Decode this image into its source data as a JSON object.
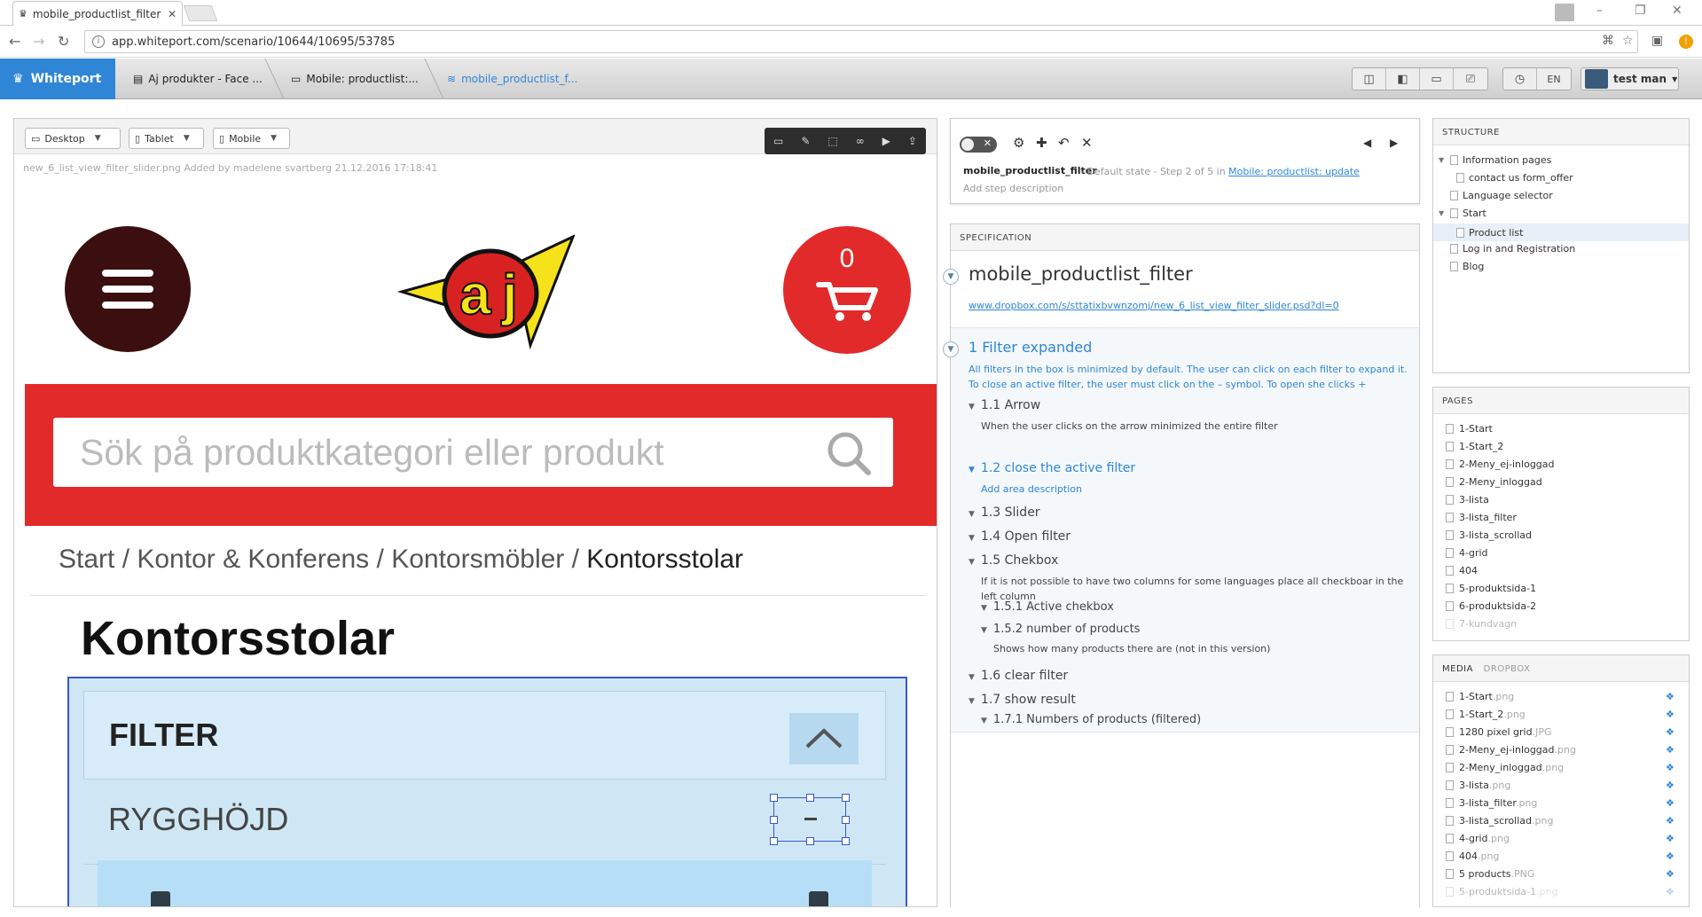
{
  "browser": {
    "tab_title": "mobile_productlist_filter",
    "url": "app.whiteport.com/scenario/10644/10695/53785"
  },
  "appbar": {
    "brand": "Whiteport",
    "crumbs": [
      "Aj produkter - Face ...",
      "Mobile: productlist:...",
      "mobile_productlist_f..."
    ],
    "lang": "EN",
    "user": "test man"
  },
  "left": {
    "devices": [
      "Desktop",
      "Tablet",
      "Mobile"
    ],
    "file_info": "new_6_list_view_filter_slider.png  Added by madelene svartberg 21.12.2016 17:18:41",
    "mock": {
      "cart_count": "0",
      "search_placeholder": "Sök på produktkategori eller produkt",
      "breadcrumb_path": "Start / Kontor & Konferens / Kontorsmöbler / ",
      "breadcrumb_current": "Kontorsstolar",
      "heading": "Kontorsstolar",
      "filter_title": "FILTER",
      "row_title": "RYGGHÖJD"
    }
  },
  "step": {
    "name": "mobile_productlist_filter",
    "meta_state": "Default state",
    "meta_step": "Step 2 of 5 in",
    "meta_link": "Mobile: productlist: update",
    "desc_placeholder": "Add step description"
  },
  "spec": {
    "header": "SPECIFICATION",
    "title": "mobile_productlist_filter",
    "link": "www.dropbox.com/s/sttatixbvwnzomj/new_6_list_view_filter_slider.psd?dl=0",
    "section_title": "1 Filter expanded",
    "section_desc": "All filters in the box is minimized by default. The user can click on each filter to expand it. To close an active filter, the user must click on the – symbol. To open she clicks +",
    "items": {
      "i11": "1.1 Arrow",
      "i11_desc": "When the user clicks on the arrow minimized the entire filter",
      "i12": "1.2 close the active filter",
      "i12_desc": "Add area description",
      "i13": "1.3 Slider",
      "i14": "1.4 Open filter",
      "i15": "1.5 Chekbox",
      "i15_desc": "If it is not possible to have two columns for some languages place all checkboar in the left column",
      "i151": "1.5.1 Active chekbox",
      "i152": "1.5.2 number of products",
      "i152_desc": "Shows how many products there are (not in this version)",
      "i16": "1.6 clear filter",
      "i17": "1.7 show result",
      "i171": "1.7.1 Numbers of products (filtered)"
    }
  },
  "structure": {
    "header": "STRUCTURE",
    "items": [
      "Information pages",
      "contact us form_offer",
      "Language selector",
      "Start",
      "Product list",
      "Log in and Registration",
      "Blog"
    ]
  },
  "pages": {
    "header": "PAGES",
    "items": [
      "1-Start",
      "1-Start_2",
      "2-Meny_ej-inloggad",
      "2-Meny_inloggad",
      "3-lista",
      "3-lista_filter",
      "3-lista_scrollad",
      "4-grid",
      "404",
      "5-produktsida-1",
      "6-produktsida-2",
      "7-kundvagn"
    ]
  },
  "media": {
    "tab_media": "MEDIA",
    "tab_dropbox": "DROPBOX",
    "items": [
      {
        "name": "1-Start",
        "ext": ".png"
      },
      {
        "name": "1-Start_2",
        "ext": ".png"
      },
      {
        "name": "1280 pixel grid",
        "ext": ".JPG"
      },
      {
        "name": "2-Meny_ej-inloggad",
        "ext": ".png"
      },
      {
        "name": "2-Meny_inloggad",
        "ext": ".png"
      },
      {
        "name": "3-lista",
        "ext": ".png"
      },
      {
        "name": "3-lista_filter",
        "ext": ".png"
      },
      {
        "name": "3-lista_scrollad",
        "ext": ".png"
      },
      {
        "name": "4-grid",
        "ext": ".png"
      },
      {
        "name": "404",
        "ext": ".png"
      },
      {
        "name": "5 products",
        "ext": ".PNG"
      },
      {
        "name": "5-produktsida-1",
        "ext": ".png"
      }
    ]
  },
  "colors": {
    "accent": "#2f86d6",
    "brand_red": "#e22a2a",
    "menu_dark": "#3b0f0f"
  }
}
